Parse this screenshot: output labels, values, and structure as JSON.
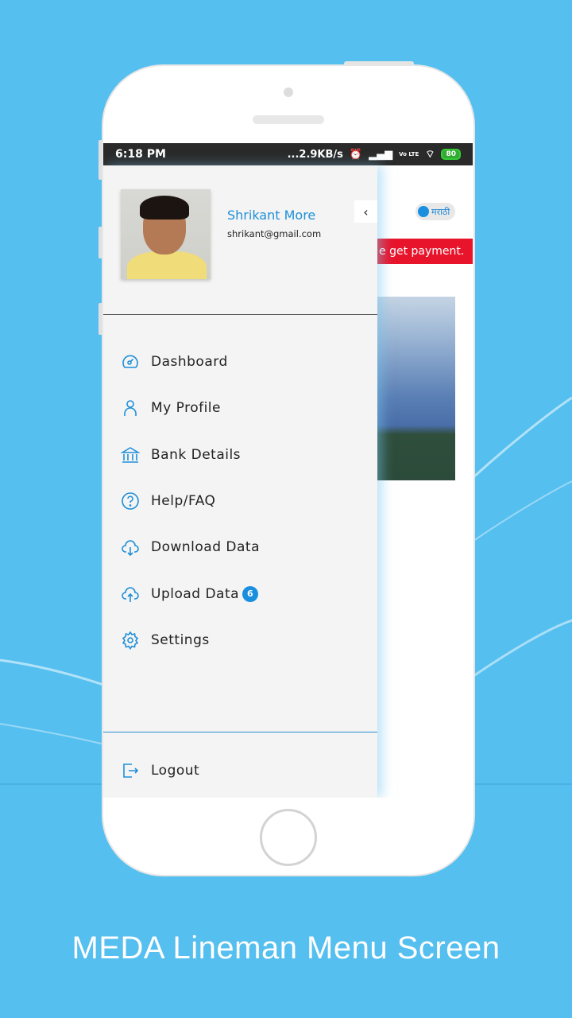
{
  "status_bar": {
    "time": "6:18 PM",
    "network_speed": "...2.9KB/s",
    "network": "Vo LTE",
    "battery": "80"
  },
  "background_screen": {
    "language_toggle": "मराठी",
    "banner_text": "e get payment."
  },
  "drawer": {
    "user_name": "Shrikant More",
    "user_email": "shrikant@gmail.com",
    "items": [
      {
        "label": "Dashboard",
        "icon": "dashboard-icon"
      },
      {
        "label": "My Profile",
        "icon": "user-icon"
      },
      {
        "label": "Bank Details",
        "icon": "bank-icon"
      },
      {
        "label": "Help/FAQ",
        "icon": "help-icon"
      },
      {
        "label": "Download Data",
        "icon": "cloud-download-icon"
      },
      {
        "label": "Upload Data",
        "icon": "cloud-upload-icon",
        "badge": "6"
      },
      {
        "label": "Settings",
        "icon": "gear-icon"
      }
    ],
    "logout": "Logout"
  },
  "colors": {
    "accent": "#1e8fd8",
    "background": "#55bfef",
    "banner": "#e8142c"
  },
  "caption": "MEDA Lineman Menu Screen"
}
